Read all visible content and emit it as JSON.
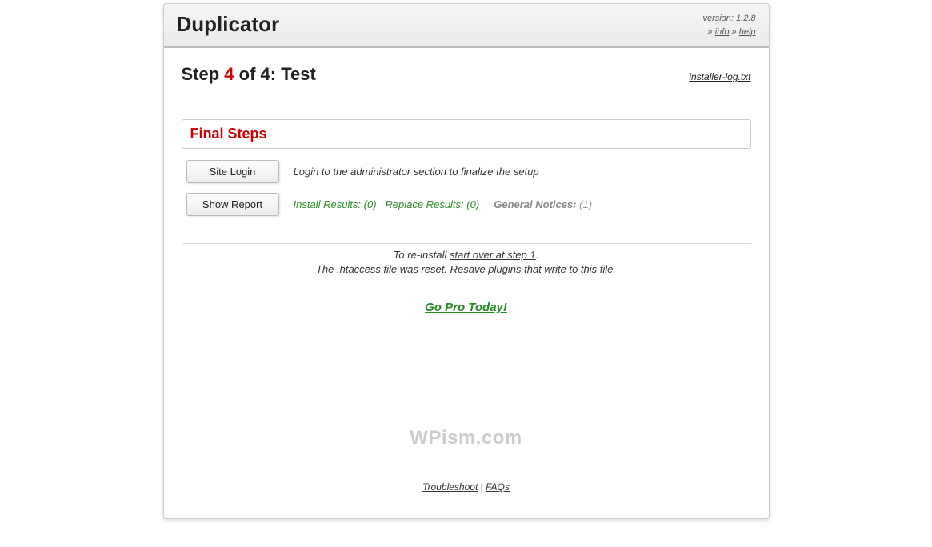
{
  "header": {
    "title": "Duplicator",
    "version_label": "version: 1.2.8",
    "info_link": "info",
    "help_link": "help",
    "sep": " » "
  },
  "step": {
    "prefix": "Step ",
    "current": "4",
    "of": " of 4: ",
    "name": "Test"
  },
  "log_link": "installer-log.txt",
  "final_steps_title": "Final Steps",
  "site_login": {
    "button": "Site Login",
    "desc": "Login to the administrator section to finalize the setup"
  },
  "show_report": {
    "button": "Show Report",
    "install_results": "Install Results: (0)",
    "replace_results": "Replace Results: (0)",
    "general_notices": "General Notices:",
    "general_count": " (1)"
  },
  "reinstall": {
    "prefix": "To re-install ",
    "link": "start over at step 1",
    "suffix": "."
  },
  "htaccess_note": "The .htaccess file was reset. Resave plugins that write to this file.",
  "gopro": "Go Pro Today!",
  "watermark": "WPism.com",
  "footer": {
    "troubleshoot": "Troubleshoot",
    "sep": " | ",
    "faqs": "FAQs"
  }
}
